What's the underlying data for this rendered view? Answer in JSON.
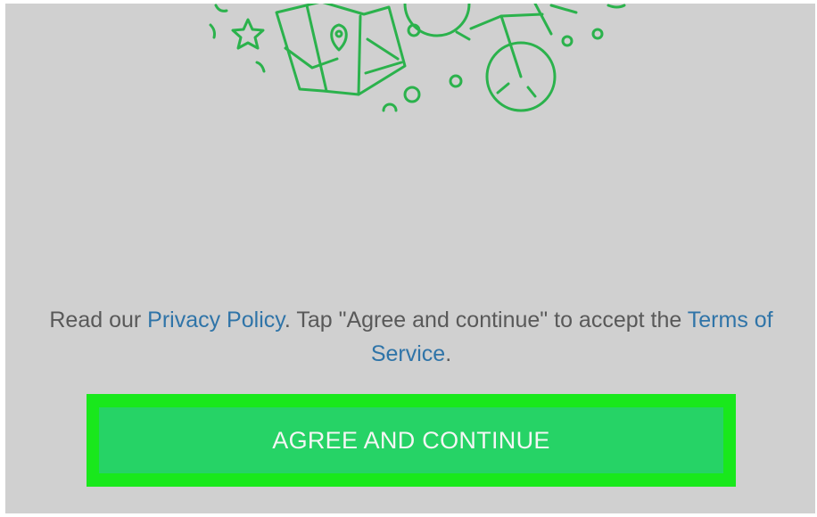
{
  "terms": {
    "prefix": "Read our ",
    "privacy_link": "Privacy Policy",
    "middle": ". Tap \"Agree and continue\" to accept the ",
    "terms_link": "Terms of Service",
    "suffix": "."
  },
  "button": {
    "label": "AGREE AND CONTINUE"
  },
  "colors": {
    "background": "#d0d0d0",
    "illustration": "#2bb24c",
    "link": "#2f74a8",
    "button": "#26d366",
    "highlight": "#19e81c"
  },
  "icons": [
    "star-icon",
    "map-icon",
    "map-pin-icon",
    "bicycle-icon"
  ]
}
